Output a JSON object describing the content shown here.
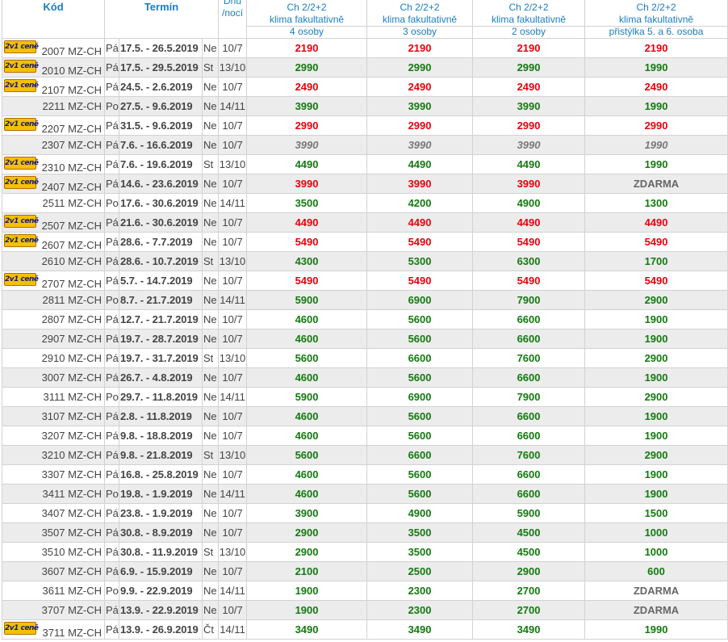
{
  "header": {
    "kod": "Kód",
    "termin": "Termín",
    "dnu_line1": "Dnů",
    "dnu_line2": "/nocí",
    "price_title": "Ch 2/2+2",
    "price_sub": "klima fakultativně",
    "cols": [
      "4 osoby",
      "3 osoby",
      "2 osoby",
      "přistýlka 5. a 6. osoba"
    ]
  },
  "badge_text": "2v1 ceně",
  "rows": [
    {
      "code": "2007 MZ-CH",
      "day": "Pá",
      "term": "17.5. - 26.5.2019",
      "dep": "Ne",
      "nights": "10/7",
      "prices": [
        "2190",
        "2190",
        "2190",
        "2190"
      ],
      "style": "red",
      "badge": true
    },
    {
      "code": "2010 MZ-CH",
      "day": "Pá",
      "term": "17.5. - 29.5.2019",
      "dep": "St",
      "nights": "13/10",
      "prices": [
        "2990",
        "2990",
        "2990",
        "1990"
      ],
      "style": "green",
      "badge": true
    },
    {
      "code": "2107 MZ-CH",
      "day": "Pá",
      "term": "24.5. - 2.6.2019",
      "dep": "Ne",
      "nights": "10/7",
      "prices": [
        "2490",
        "2490",
        "2490",
        "2490"
      ],
      "style": "red",
      "badge": true
    },
    {
      "code": "2211 MZ-CH",
      "day": "Po",
      "term": "27.5. - 9.6.2019",
      "dep": "Ne",
      "nights": "14/11",
      "prices": [
        "3990",
        "3990",
        "3990",
        "1990"
      ],
      "style": "green",
      "badge": false
    },
    {
      "code": "2207 MZ-CH",
      "day": "Pá",
      "term": "31.5. - 9.6.2019",
      "dep": "Ne",
      "nights": "10/7",
      "prices": [
        "2990",
        "2990",
        "2990",
        "2990"
      ],
      "style": "red",
      "badge": true
    },
    {
      "code": "2307 MZ-CH",
      "day": "Pá",
      "term": "7.6. - 16.6.2019",
      "dep": "Ne",
      "nights": "10/7",
      "prices": [
        "3990",
        "3990",
        "3990",
        "1990"
      ],
      "style": "gray",
      "badge": false
    },
    {
      "code": "2310 MZ-CH",
      "day": "Pá",
      "term": "7.6. - 19.6.2019",
      "dep": "St",
      "nights": "13/10",
      "prices": [
        "4490",
        "4490",
        "4490",
        "1990"
      ],
      "style": "green",
      "badge": true
    },
    {
      "code": "2407 MZ-CH",
      "day": "Pá",
      "term": "14.6. - 23.6.2019",
      "dep": "Ne",
      "nights": "10/7",
      "prices": [
        "3990",
        "3990",
        "3990",
        "ZDARMA"
      ],
      "style": "red",
      "badge": true
    },
    {
      "code": "2511 MZ-CH",
      "day": "Po",
      "term": "17.6. - 30.6.2019",
      "dep": "Ne",
      "nights": "14/11",
      "prices": [
        "3500",
        "4200",
        "4900",
        "1300"
      ],
      "style": "green",
      "badge": false
    },
    {
      "code": "2507 MZ-CH",
      "day": "Pá",
      "term": "21.6. - 30.6.2019",
      "dep": "Ne",
      "nights": "10/7",
      "prices": [
        "4490",
        "4490",
        "4490",
        "4490"
      ],
      "style": "red",
      "badge": true
    },
    {
      "code": "2607 MZ-CH",
      "day": "Pá",
      "term": "28.6. - 7.7.2019",
      "dep": "Ne",
      "nights": "10/7",
      "prices": [
        "5490",
        "5490",
        "5490",
        "5490"
      ],
      "style": "red",
      "badge": true
    },
    {
      "code": "2610 MZ-CH",
      "day": "Pá",
      "term": "28.6. - 10.7.2019",
      "dep": "St",
      "nights": "13/10",
      "prices": [
        "4300",
        "5300",
        "6300",
        "1700"
      ],
      "style": "green",
      "badge": false
    },
    {
      "code": "2707 MZ-CH",
      "day": "Pá",
      "term": "5.7. - 14.7.2019",
      "dep": "Ne",
      "nights": "10/7",
      "prices": [
        "5490",
        "5490",
        "5490",
        "5490"
      ],
      "style": "red",
      "badge": true
    },
    {
      "code": "2811 MZ-CH",
      "day": "Po",
      "term": "8.7. - 21.7.2019",
      "dep": "Ne",
      "nights": "14/11",
      "prices": [
        "5900",
        "6900",
        "7900",
        "2900"
      ],
      "style": "green",
      "badge": false
    },
    {
      "code": "2807 MZ-CH",
      "day": "Pá",
      "term": "12.7. - 21.7.2019",
      "dep": "Ne",
      "nights": "10/7",
      "prices": [
        "4600",
        "5600",
        "6600",
        "1900"
      ],
      "style": "green",
      "badge": false
    },
    {
      "code": "2907 MZ-CH",
      "day": "Pá",
      "term": "19.7. - 28.7.2019",
      "dep": "Ne",
      "nights": "10/7",
      "prices": [
        "4600",
        "5600",
        "6600",
        "1900"
      ],
      "style": "green",
      "badge": false
    },
    {
      "code": "2910 MZ-CH",
      "day": "Pá",
      "term": "19.7. - 31.7.2019",
      "dep": "St",
      "nights": "13/10",
      "prices": [
        "5600",
        "6600",
        "7600",
        "2900"
      ],
      "style": "green",
      "badge": false
    },
    {
      "code": "3007 MZ-CH",
      "day": "Pá",
      "term": "26.7. - 4.8.2019",
      "dep": "Ne",
      "nights": "10/7",
      "prices": [
        "4600",
        "5600",
        "6600",
        "1900"
      ],
      "style": "green",
      "badge": false
    },
    {
      "code": "3111 MZ-CH",
      "day": "Po",
      "term": "29.7. - 11.8.2019",
      "dep": "Ne",
      "nights": "14/11",
      "prices": [
        "5900",
        "6900",
        "7900",
        "2900"
      ],
      "style": "green",
      "badge": false
    },
    {
      "code": "3107 MZ-CH",
      "day": "Pá",
      "term": "2.8. - 11.8.2019",
      "dep": "Ne",
      "nights": "10/7",
      "prices": [
        "4600",
        "5600",
        "6600",
        "1900"
      ],
      "style": "green",
      "badge": false
    },
    {
      "code": "3207 MZ-CH",
      "day": "Pá",
      "term": "9.8. - 18.8.2019",
      "dep": "Ne",
      "nights": "10/7",
      "prices": [
        "4600",
        "5600",
        "6600",
        "1900"
      ],
      "style": "green",
      "badge": false
    },
    {
      "code": "3210 MZ-CH",
      "day": "Pá",
      "term": "9.8. - 21.8.2019",
      "dep": "St",
      "nights": "13/10",
      "prices": [
        "5600",
        "6600",
        "7600",
        "2900"
      ],
      "style": "green",
      "badge": false
    },
    {
      "code": "3307 MZ-CH",
      "day": "Pá",
      "term": "16.8. - 25.8.2019",
      "dep": "Ne",
      "nights": "10/7",
      "prices": [
        "4600",
        "5600",
        "6600",
        "1900"
      ],
      "style": "green",
      "badge": false
    },
    {
      "code": "3411 MZ-CH",
      "day": "Po",
      "term": "19.8. - 1.9.2019",
      "dep": "Ne",
      "nights": "14/11",
      "prices": [
        "4600",
        "5600",
        "6600",
        "1900"
      ],
      "style": "green",
      "badge": false
    },
    {
      "code": "3407 MZ-CH",
      "day": "Pá",
      "term": "23.8. - 1.9.2019",
      "dep": "Ne",
      "nights": "10/7",
      "prices": [
        "3900",
        "4900",
        "5900",
        "1500"
      ],
      "style": "green",
      "badge": false
    },
    {
      "code": "3507 MZ-CH",
      "day": "Pá",
      "term": "30.8. - 8.9.2019",
      "dep": "Ne",
      "nights": "10/7",
      "prices": [
        "2900",
        "3500",
        "4500",
        "1000"
      ],
      "style": "green",
      "badge": false
    },
    {
      "code": "3510 MZ-CH",
      "day": "Pá",
      "term": "30.8. - 11.9.2019",
      "dep": "St",
      "nights": "13/10",
      "prices": [
        "2900",
        "3500",
        "4500",
        "1000"
      ],
      "style": "green",
      "badge": false
    },
    {
      "code": "3607 MZ-CH",
      "day": "Pá",
      "term": "6.9. - 15.9.2019",
      "dep": "Ne",
      "nights": "10/7",
      "prices": [
        "2100",
        "2500",
        "2900",
        "600"
      ],
      "style": "green",
      "badge": false
    },
    {
      "code": "3611 MZ-CH",
      "day": "Po",
      "term": "9.9. - 22.9.2019",
      "dep": "Ne",
      "nights": "14/11",
      "prices": [
        "1900",
        "2300",
        "2700",
        "ZDARMA"
      ],
      "style": "green",
      "badge": false
    },
    {
      "code": "3707 MZ-CH",
      "day": "Pá",
      "term": "13.9. - 22.9.2019",
      "dep": "Ne",
      "nights": "10/7",
      "prices": [
        "1900",
        "2300",
        "2700",
        "ZDARMA"
      ],
      "style": "green",
      "badge": false
    },
    {
      "code": "3711 MZ-CH",
      "day": "Pá",
      "term": "13.9. - 26.9.2019",
      "dep": "Čt",
      "nights": "14/11",
      "prices": [
        "3490",
        "3490",
        "3490",
        "1990"
      ],
      "style": "green",
      "badge": true
    }
  ],
  "colors": {
    "red": "#e8000b",
    "green": "#137a0f",
    "header": "#1a7dc2",
    "row_alt": "#ececec"
  }
}
